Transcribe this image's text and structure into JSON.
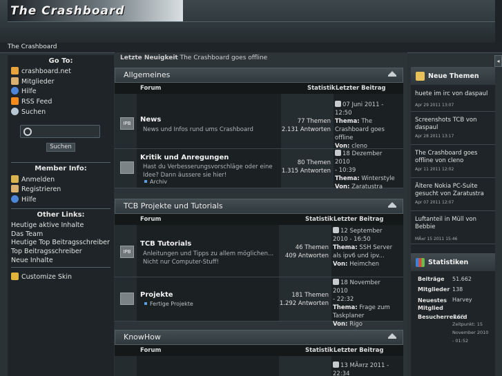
{
  "header": {
    "logo_text": "The Crashboard",
    "breadcrumb": "The Crashboard",
    "toggle_glyph": "◂"
  },
  "news": {
    "label": "Letzte Neuigkeit",
    "text": "The Crashboard goes offline"
  },
  "left": {
    "goto_title": "Go To:",
    "goto_items": [
      "crashboard.net",
      "Mitglieder",
      "Hilfe",
      "RSS Feed",
      "Suchen"
    ],
    "search_button": "Suchen",
    "member_title": "Member Info:",
    "member_items": [
      "Anmelden",
      "Registrieren",
      "Hilfe"
    ],
    "other_title": "Other Links:",
    "other_items": [
      "Heutige aktive Inhalte",
      "Das Team",
      "Heutige Top Beitragsschreiber",
      "Top Beitragsschreiber",
      "Neue Inhalte"
    ],
    "skin": "Customize Skin"
  },
  "cols": {
    "forum": "Forum",
    "statistik": "Statistik",
    "letzter": "Letzter Beitrag"
  },
  "categories": [
    {
      "title": "Allgemeines",
      "forums": [
        {
          "icon": "IPB",
          "title": "News",
          "desc": "News und Infos rund ums Crashboard",
          "sub": "",
          "themen": "77 Themen",
          "antworten": "2.131 Antworten",
          "date1": "07 Juni 2011 -",
          "date2": "12:50",
          "thema_label": "Thema:",
          "thema": "The",
          "thema2": "Crashboard goes",
          "thema3": "offline",
          "von_label": "Von:",
          "von": "cleno"
        },
        {
          "icon": "",
          "title": "Kritik und Anregungen",
          "desc": "Hast du Verbesserungsvorschläge oder eine",
          "desc2": "Idee? Dann äussere sie hier!",
          "sub": "Archiv",
          "themen": "80 Themen",
          "antworten": "1.315 Antworten",
          "date1": "18 Dezember 2010",
          "date2": "- 10:39",
          "thema_label": "Thema:",
          "thema": "Winterstyle",
          "von_label": "Von:",
          "von": "Zaratustra"
        }
      ]
    },
    {
      "title": "TCB Projekte und Tutorials",
      "forums": [
        {
          "icon": "IPB",
          "title": "TCB Tutorials",
          "desc": "Anleitungen und Tipps zu allem möglichen...",
          "desc2": "Nicht nur Computer-Stuff!",
          "sub": "",
          "themen": "46 Themen",
          "antworten": "409 Antworten",
          "date1": "12 September",
          "date2": "2010 - 16:50",
          "thema_label": "Thema:",
          "thema": "SSH Server",
          "thema2": "als ipv6 und ipv...",
          "von_label": "Von:",
          "von": "Heimchen"
        },
        {
          "icon": "",
          "title": "Projekte",
          "desc": "",
          "sub": "Fertige Projekte",
          "themen": "181 Themen",
          "antworten": "1.292 Antworten",
          "date1": "18 November 2010",
          "date2": "- 22:32",
          "thema_label": "Thema:",
          "thema": "Frage zum",
          "thema2": "Taskplaner",
          "von_label": "Von:",
          "von": "Rigo"
        }
      ]
    },
    {
      "title": "KnowHow",
      "forums": [
        {
          "date1": "13 MÃ¤rz 2011 -",
          "date2": "22:34"
        }
      ]
    }
  ],
  "right": {
    "new_title": "Neue Themen",
    "topics": [
      {
        "text": "huete im irc",
        "von": "von",
        "user": "daspaul",
        "date": "Apr 29 2011 13:07"
      },
      {
        "text": "Screenshots TCB",
        "von": "von",
        "user": "daspaul",
        "date": "Apr 28 2011 13:17"
      },
      {
        "text": "The Crashboard goes offline",
        "von": "von",
        "user": "cleno",
        "date": "Apr 11 2011 12:02"
      },
      {
        "text": "Ältere Nokia PC-Suite gesucht",
        "von": "von",
        "user": "Zaratustra",
        "date": "Apr 07 2011 12:07"
      },
      {
        "text": "Luftanteil in Müll",
        "von": "von",
        "user": "Bebbie",
        "date": "MÃ¤r 15 2011 15:46"
      }
    ],
    "stats_title": "Statistiken",
    "stats": [
      {
        "label": "Beiträge",
        "value": "51.662"
      },
      {
        "label": "Mitglieder",
        "value": "138"
      },
      {
        "label": "Neuestes Mitglied",
        "value": "Harvey"
      },
      {
        "label": "Besucherrekord",
        "value": "166"
      }
    ],
    "record_note": [
      "Zeitpunkt: 15",
      "November 2010",
      "- 01:52"
    ]
  }
}
